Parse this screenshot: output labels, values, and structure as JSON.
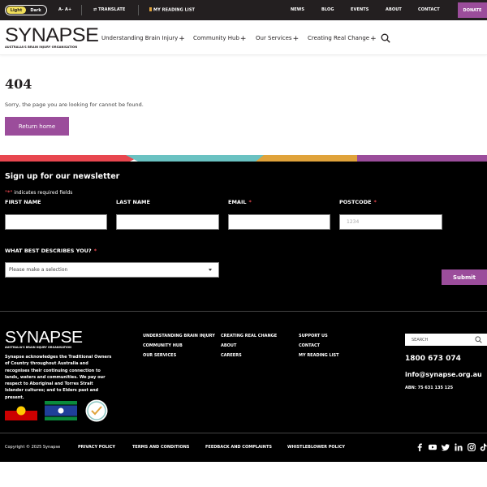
{
  "topbar": {
    "theme_light": "Light",
    "theme_dark": "Dark",
    "text_size": "A- A+",
    "translate": "TRANSLATE",
    "reading_list": "MY READING LIST",
    "links": [
      "NEWS",
      "BLOG",
      "EVENTS",
      "ABOUT",
      "CONTACT"
    ],
    "donate": "DONATE"
  },
  "brand": {
    "name": "SYNAPSE",
    "tagline": "AUSTRALIA'S BRAIN INJURY ORGANISATION",
    "accent": "#9b4d9b"
  },
  "nav": {
    "items": [
      "Understanding Brain Injury",
      "Community Hub",
      "Our Services",
      "Creating Real Change"
    ]
  },
  "error": {
    "code": "404",
    "message": "Sorry, the page you are looking for cannot be found.",
    "button": "Return home"
  },
  "newsletter": {
    "title": "Sign up for our newsletter",
    "required_note_star": "\"*\"",
    "required_note": " indicates required fields",
    "first_name": "FIRST NAME",
    "last_name": "LAST NAME",
    "email": "EMAIL",
    "postcode": "POSTCODE",
    "postcode_placeholder": "1234",
    "question": "WHAT BEST DESCRIBES YOU?",
    "select_placeholder": "Please make a selection",
    "submit": "Submit",
    "required_mark": "*"
  },
  "footer": {
    "acknowledgement": "Synapse acknowledges the Traditional Owners of Country throughout Australia and recognises their continuing connection to lands, waters and communities. We pay our respect to Aboriginal and Torres Strait Islander cultures; and to Elders past and present.",
    "col1": [
      "UNDERSTANDING BRAIN INJURY",
      "COMMUNITY HUB",
      "OUR SERVICES"
    ],
    "col2": [
      "CREATING REAL CHANGE",
      "ABOUT",
      "CAREERS"
    ],
    "col3": [
      "SUPPORT US",
      "CONTACT",
      "MY READING LIST"
    ],
    "search_placeholder": "SEARCH",
    "phone": "1800 673 074",
    "email": "info@synapse.org.au",
    "abn": "ABN: 75 631 135 125",
    "copyright": "Copyright © 2025 Synapse",
    "bottom_links": [
      "PRIVACY POLICY",
      "TERMS AND CONDITIONS",
      "FEEDBACK AND COMPLAINTS",
      "WHISTLEBLOWER POLICY"
    ],
    "social_icons": [
      "facebook-icon",
      "youtube-icon",
      "twitter-icon",
      "linkedin-icon",
      "instagram-icon",
      "tiktok-icon"
    ]
  },
  "colors": {
    "stripe": [
      "#e8474f",
      "#6ac2c2",
      "#e0a33b",
      "#9b4d9b"
    ],
    "required": "#e8474f"
  }
}
